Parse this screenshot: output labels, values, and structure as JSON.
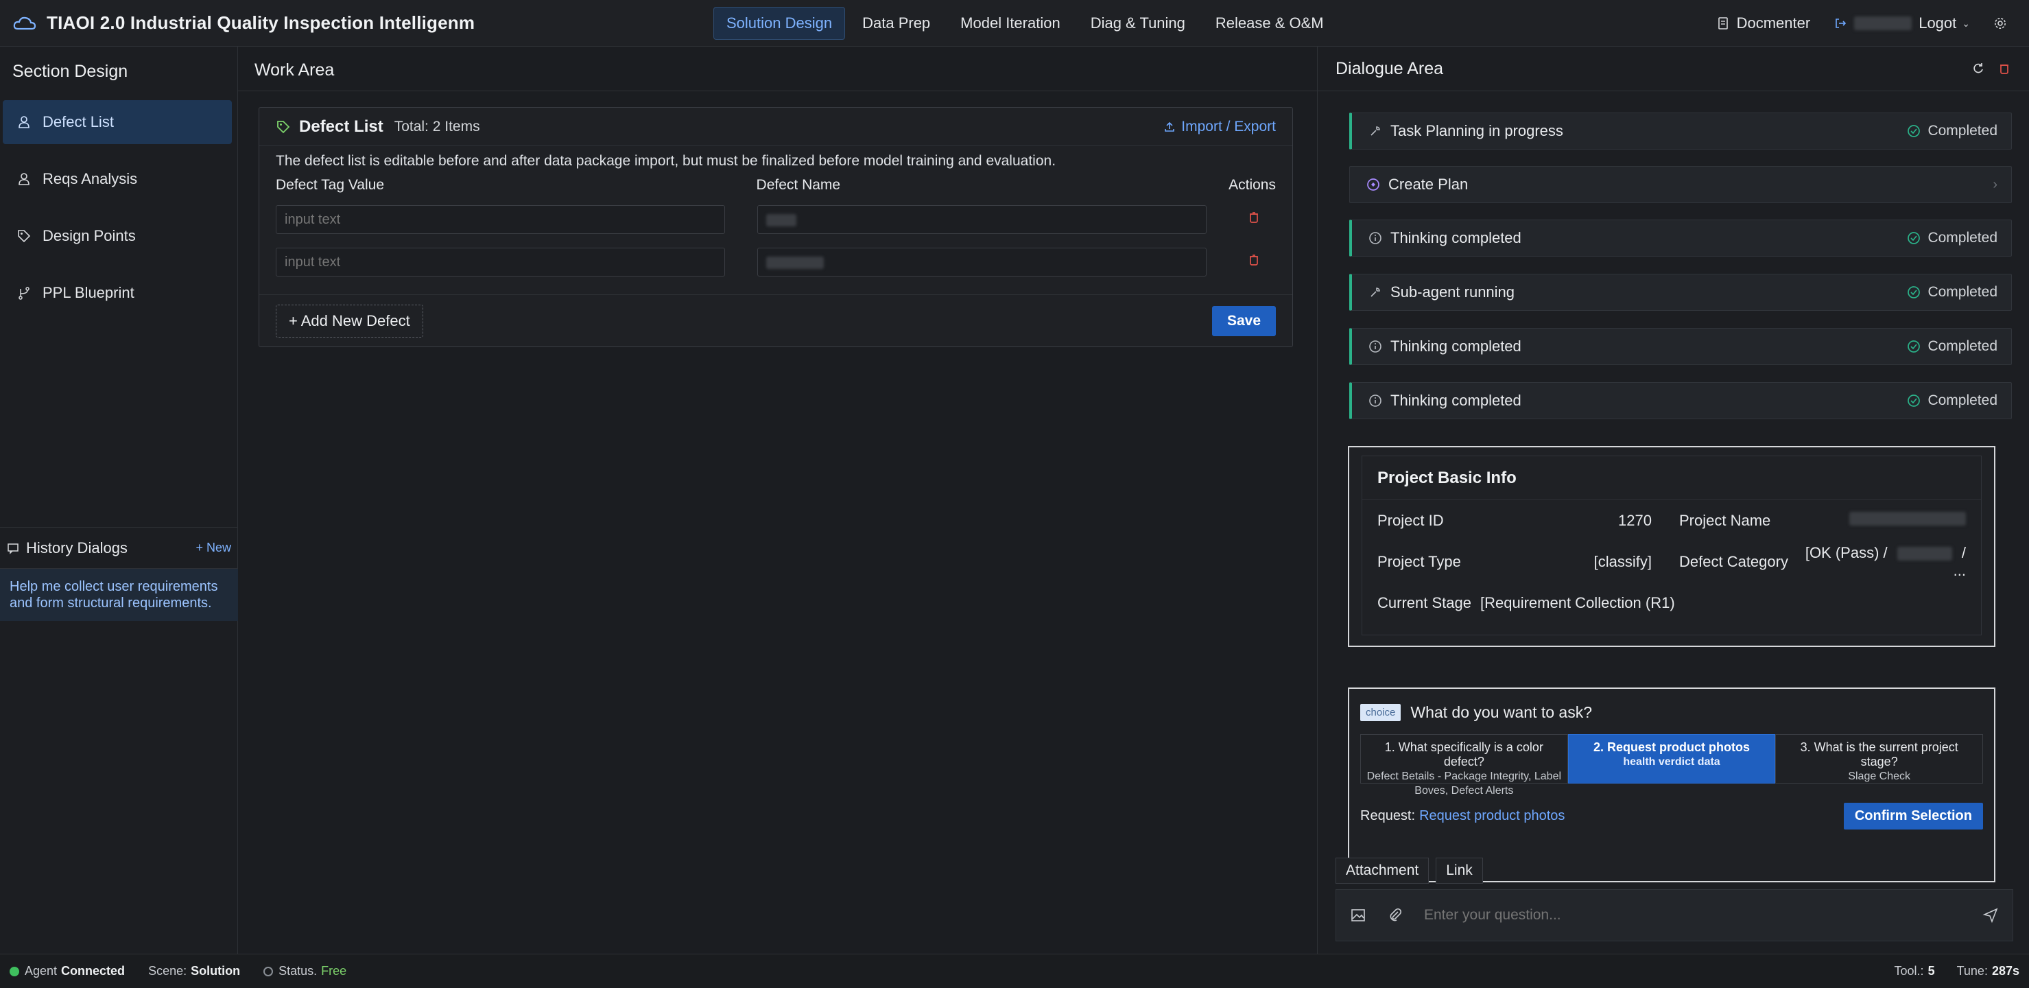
{
  "app": {
    "title": "TIAOI 2.0 Industrial Quality Inspection Intelligenm"
  },
  "nav": {
    "tabs": [
      "Solution Design",
      "Data Prep",
      "Model Iteration",
      "Diag & Tuning",
      "Release & O&M"
    ],
    "active": 0
  },
  "top_right": {
    "docs": "Docmenter",
    "logout": "Logot"
  },
  "sidebar": {
    "title": "Section Design",
    "items": [
      {
        "label": "Defect List",
        "icon": "user-icon",
        "active": true
      },
      {
        "label": "Reqs Analysis",
        "icon": "user-icon"
      },
      {
        "label": "Design Points",
        "icon": "tag-icon"
      },
      {
        "label": "PPL Blueprint",
        "icon": "branch-icon"
      }
    ],
    "history": {
      "title": "History Dialogs",
      "new_label": "+ New",
      "entry": "Help me collect user requirements and form structural requirements."
    }
  },
  "work": {
    "title": "Work Area",
    "panel": {
      "title": "Defect List",
      "total": "Total: 2 Items",
      "import_export": "Import / Export",
      "description": "The defect list is editable before and after data package import, but must be finalized before model training and evaluation.",
      "columns": [
        "Defect Tag Value",
        "Defect Name",
        "Actions"
      ],
      "rows": [
        {
          "tag_placeholder": "input text"
        },
        {
          "tag_placeholder": "input text"
        }
      ],
      "add_label": "+ Add New Defect",
      "save_label": "Save"
    }
  },
  "dialog": {
    "title": "Dialogue Area",
    "tasks": [
      {
        "label": "Task Planning in progress",
        "status": "Completed",
        "icon": "wrench-icon"
      },
      {
        "label": "Create Plan",
        "status": "",
        "icon": "plan-icon"
      },
      {
        "label": "Thinking completed",
        "status": "Completed",
        "icon": "info-icon"
      },
      {
        "label": "Sub-agent running",
        "status": "Completed",
        "icon": "wrench-icon"
      },
      {
        "label": "Thinking completed",
        "status": "Completed",
        "icon": "info-icon"
      },
      {
        "label": "Thinking completed",
        "status": "Completed",
        "icon": "info-icon"
      }
    ],
    "project": {
      "title": "Project Basic Info",
      "id_label": "Project ID",
      "id_value": "1270",
      "name_label": "Project Name",
      "type_label": "Project Type",
      "type_value": "[classify]",
      "category_label": "Defect Category",
      "category_value_a": "[OK (Pass) /",
      "category_value_b": "/ ...",
      "stage_label": "Current Stage",
      "stage_value": "[Requirement Collection (R1)"
    },
    "ask": {
      "badge": "choice",
      "question": "What do you want to ask?",
      "choices": [
        {
          "title": "1.  What specifically is a color defect?",
          "sub": "Defect Betails - Package Integrity, Label Boves, Defect Alerts"
        },
        {
          "title": "2. Request product photos",
          "sub": "health verdict data",
          "selected": true
        },
        {
          "title": "3. What is the surrent project stage?",
          "sub": "Slage Check"
        }
      ],
      "request_label": "Request:",
      "request_value": "Request product photos",
      "confirm": "Confirm Selection"
    },
    "attach_label": "Attachment",
    "link_label": "Link",
    "input_placeholder": "Enter your question..."
  },
  "statusbar": {
    "agent_label": "Agent",
    "agent_value": "Connected",
    "scene_label": "Scene:",
    "scene_value": "Solution",
    "status_label": "Status.",
    "status_value": "Free",
    "tool_label": "Tool.:",
    "tool_value": "5",
    "tune_label": "Tune:",
    "tune_value": "287s"
  },
  "colors": {
    "accent": "#1f5fbf",
    "success": "#2bb38a",
    "danger": "#e0524a",
    "link": "#6fa8ff"
  }
}
